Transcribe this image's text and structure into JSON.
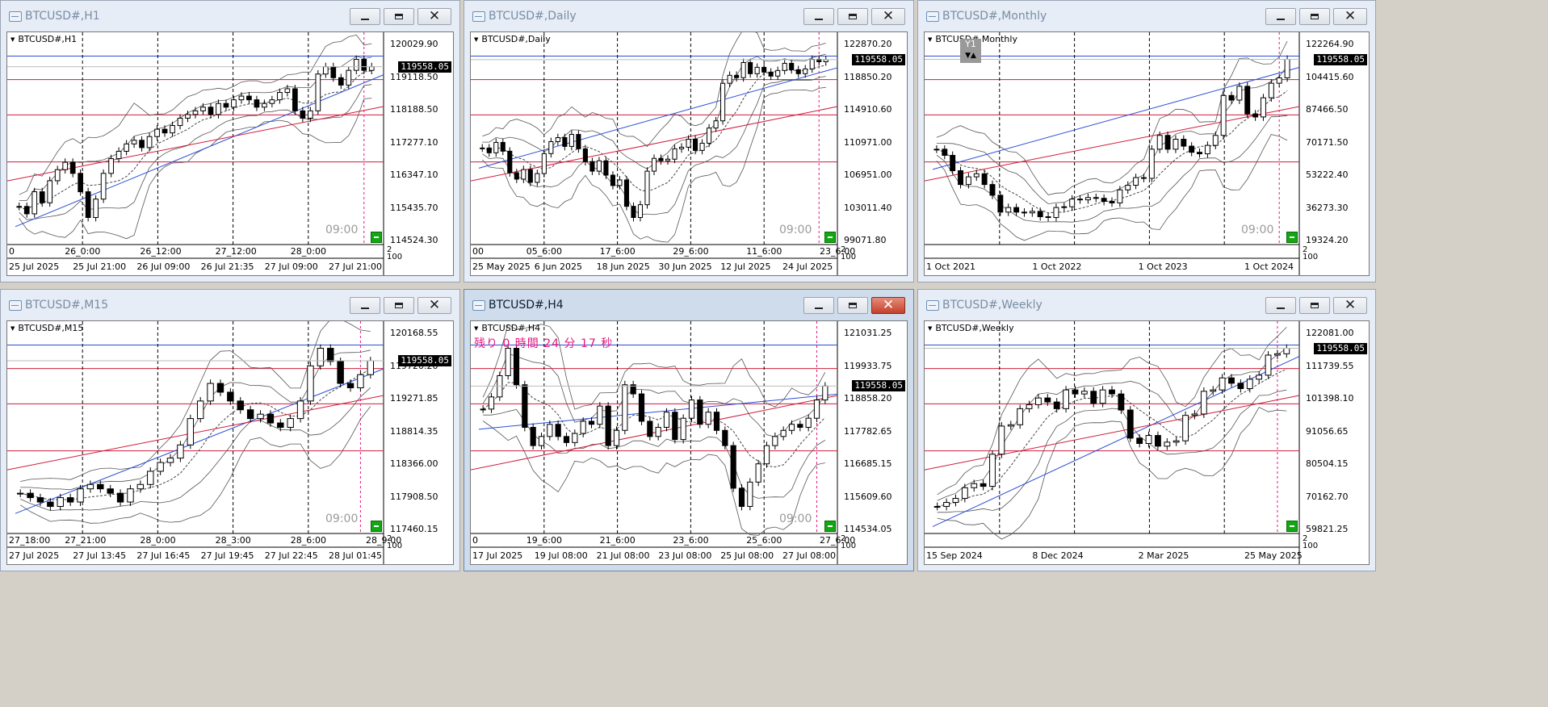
{
  "windows": [
    {
      "id": "h1",
      "title": "BTCUSD#,H1",
      "label": "BTCUSD#,H1",
      "active": false,
      "time_note": "09:00",
      "price_tag": "119558.05",
      "y_labels": [
        "120029.90",
        "119118.50",
        "118188.50",
        "117277.10",
        "116347.10",
        "115435.70",
        "114524.30"
      ],
      "upper_time_labels": [
        "0",
        "26_0:00",
        "26_12:00",
        "27_12:00",
        "28_0:00"
      ],
      "date_labels": [
        "25 Jul 2025",
        "25 Jul 21:00",
        "26 Jul 09:00",
        "26 Jul 21:35",
        "27 Jul 09:00",
        "27 Jul 21:00"
      ],
      "bottom_axis": [
        "2",
        "100"
      ],
      "series": [
        115800,
        115600,
        116200,
        115900,
        116500,
        116800,
        117000,
        116700,
        116200,
        115500,
        116000,
        116700,
        117100,
        117300,
        117500,
        117600,
        117400,
        117700,
        117900,
        117800,
        118000,
        118200,
        118300,
        118400,
        118500,
        118300,
        118600,
        118500,
        118700,
        118800,
        118700,
        118500,
        118600,
        118700,
        118900,
        119000,
        118400,
        118200,
        118400,
        119400,
        119600,
        119300,
        119100,
        119500,
        119800,
        119500,
        119600
      ]
    },
    {
      "id": "daily",
      "title": "BTCUSD#,Daily",
      "label": "BTCUSD#,Daily",
      "active": false,
      "time_note": "09:00",
      "price_tag": "119558.05",
      "y_labels": [
        "122870.20",
        "118850.20",
        "114910.60",
        "110971.00",
        "106951.00",
        "103011.40",
        "99071.80"
      ],
      "upper_time_labels": [
        "00",
        "05_6:00",
        "17_6:00",
        "29_6:00",
        "11_6:00",
        "23_6:00"
      ],
      "date_labels": [
        "25 May 2025",
        "6 Jun 2025",
        "18 Jun 2025",
        "30 Jun 2025",
        "12 Jul 2025",
        "24 Jul 2025"
      ],
      "bottom_axis": [
        "2",
        "100"
      ],
      "series": [
        108500,
        107900,
        109200,
        108100,
        105400,
        104600,
        105800,
        104200,
        105300,
        107800,
        109300,
        109800,
        108700,
        110200,
        108400,
        106800,
        105600,
        106900,
        105100,
        103800,
        104500,
        101200,
        99800,
        101400,
        105600,
        107200,
        106900,
        107100,
        108400,
        108600,
        109600,
        108200,
        109100,
        111000,
        111900,
        116600,
        117600,
        117300,
        119200,
        117800,
        118600,
        118000,
        117500,
        118200,
        119100,
        118300,
        117800,
        118400,
        119600,
        119300,
        119558
      ]
    },
    {
      "id": "monthly",
      "title": "BTCUSD#,Monthly",
      "label": "BTCUSD#,Monthly",
      "active": false,
      "time_note": "09:00",
      "price_tag": "119558.05",
      "y1_button": "Y1",
      "y_labels": [
        "122264.90",
        "104415.60",
        "87466.50",
        "70171.50",
        "53222.40",
        "36273.30",
        "19324.20"
      ],
      "upper_time_labels": [],
      "date_labels": [
        "1 Oct 2021",
        "1 Oct 2022",
        "1 Oct 2023",
        "1 Oct 2024"
      ],
      "bottom_axis": [
        "2",
        "100"
      ],
      "series": [
        61000,
        57000,
        47000,
        38000,
        43000,
        45000,
        38000,
        31000,
        20000,
        23000,
        20000,
        19500,
        20500,
        17000,
        16500,
        23000,
        23500,
        28500,
        28000,
        29500,
        29000,
        27000,
        26000,
        34500,
        37500,
        42500,
        42000,
        61000,
        70000,
        61000,
        67500,
        63000,
        59000,
        58000,
        63500,
        70000,
        96000,
        93000,
        102000,
        84000,
        82000,
        94500,
        104000,
        107500,
        119558
      ]
    },
    {
      "id": "m15",
      "title": "BTCUSD#,M15",
      "label": "BTCUSD#,M15",
      "active": false,
      "time_note": "09:00",
      "price_tag": "119558.05",
      "y_labels": [
        "120168.55",
        "119720.20",
        "119271.85",
        "118814.35",
        "118366.00",
        "117908.50",
        "117460.15"
      ],
      "upper_time_labels": [
        "27_18:00",
        "27_21:00",
        "28_0:00",
        "28_3:00",
        "28_6:00",
        "28_9:00"
      ],
      "date_labels": [
        "27 Jul 2025",
        "27 Jul 13:45",
        "27 Jul 16:45",
        "27 Jul 19:45",
        "27 Jul 22:45",
        "28 Jul 01:45"
      ],
      "bottom_axis": [
        "2",
        "100"
      ],
      "series": [
        118050,
        118000,
        117950,
        117900,
        118000,
        117950,
        118100,
        118150,
        118100,
        118050,
        117950,
        118100,
        118150,
        118300,
        118400,
        118450,
        118600,
        118900,
        119100,
        119300,
        119200,
        119100,
        119000,
        118900,
        118950,
        118850,
        118800,
        118900,
        119100,
        119500,
        119700,
        119550,
        119300,
        119250,
        119400,
        119558
      ]
    },
    {
      "id": "h4",
      "title": "BTCUSD#,H4",
      "label": "BTCUSD#,H4",
      "active": true,
      "countdown": "残り 0 時間 24 分 17 秒",
      "time_note": "09:00",
      "price_tag": "119558.05",
      "y_labels": [
        "121031.25",
        "119933.75",
        "118858.20",
        "117782.65",
        "116685.15",
        "115609.60",
        "114534.05"
      ],
      "upper_time_labels": [
        "0",
        "19_6:00",
        "21_6:00",
        "23_6:00",
        "25_6:00",
        "27_6:00"
      ],
      "date_labels": [
        "17 Jul 2025",
        "19 Jul 08:00",
        "21 Jul 08:00",
        "23 Jul 08:00",
        "25 Jul 08:00",
        "27 Jul 08:00"
      ],
      "bottom_axis": [
        "2",
        "100"
      ],
      "series": [
        118800,
        119200,
        119900,
        120800,
        119600,
        118200,
        117600,
        117900,
        118300,
        117900,
        117700,
        118000,
        118400,
        118300,
        118900,
        117600,
        118100,
        119600,
        119300,
        118400,
        117900,
        118200,
        118700,
        117800,
        118500,
        119100,
        118300,
        118700,
        118100,
        117600,
        116200,
        115600,
        116400,
        117000,
        117600,
        117900,
        118100,
        118300,
        118200,
        118500,
        119100,
        119558
      ]
    },
    {
      "id": "weekly",
      "title": "BTCUSD#,Weekly",
      "label": "BTCUSD#,Weekly",
      "active": false,
      "time_note": "",
      "price_tag": "119558.05",
      "y_labels": [
        "122081.00",
        "111739.55",
        "101398.10",
        "91056.65",
        "80504.15",
        "70162.70",
        "59821.25"
      ],
      "upper_time_labels": [],
      "date_labels": [
        "15 Sep 2024",
        "8 Dec 2024",
        "2 Mar 2025",
        "25 May 2025"
      ],
      "bottom_axis": [
        "2",
        "100"
      ],
      "series": [
        60500,
        62000,
        63500,
        67500,
        69000,
        68000,
        80000,
        90500,
        91000,
        97000,
        98500,
        101000,
        99500,
        97000,
        104000,
        102500,
        103500,
        99000,
        104000,
        102500,
        96500,
        86000,
        84000,
        87000,
        83000,
        84500,
        85000,
        94500,
        95000,
        103500,
        104000,
        108500,
        106500,
        104500,
        108000,
        109500,
        117000,
        117500,
        119558
      ]
    }
  ]
}
